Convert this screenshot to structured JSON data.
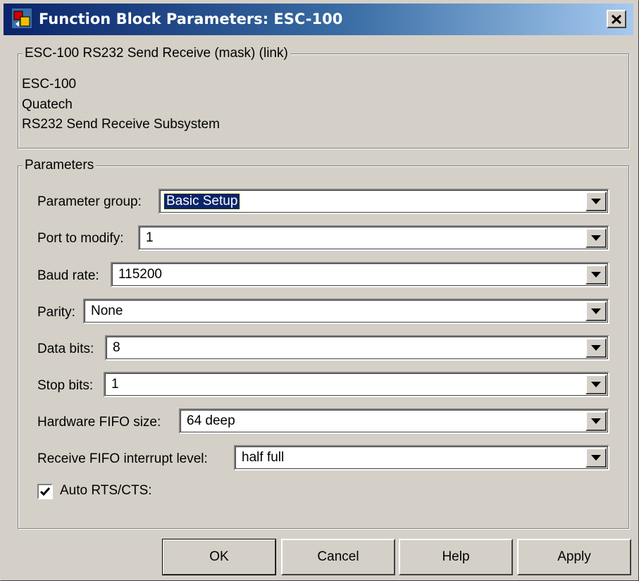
{
  "window": {
    "title": "Function Block Parameters: ESC-100"
  },
  "description": {
    "group_label": "ESC-100 RS232 Send Receive (mask) (link)",
    "lines": [
      "ESC-100",
      "Quatech",
      "RS232 Send Receive Subsystem"
    ]
  },
  "parameters": {
    "group_label": "Parameters",
    "fields": [
      {
        "label": "Parameter group:",
        "value": "Basic Setup"
      },
      {
        "label": "Port to modify:",
        "value": "1"
      },
      {
        "label": "Baud rate:",
        "value": "115200"
      },
      {
        "label": "Parity:",
        "value": "None"
      },
      {
        "label": "Data bits:",
        "value": "8"
      },
      {
        "label": "Stop bits:",
        "value": "1"
      },
      {
        "label": "Hardware FIFO size:",
        "value": "64 deep"
      },
      {
        "label": "Receive FIFO interrupt level:",
        "value": "half full"
      }
    ],
    "checkbox": {
      "label": "Auto RTS/CTS:",
      "checked": true
    }
  },
  "buttons": {
    "ok": "OK",
    "cancel": "Cancel",
    "help": "Help",
    "apply": "Apply"
  },
  "colors": {
    "titlebar_start": "#0a246a",
    "titlebar_end": "#a6caf0",
    "face": "#d4d0c8",
    "selection": "#0a246a"
  },
  "icons": {
    "app": "simulink-block-icon",
    "close": "close-x-icon",
    "dropdown": "triangle-down-icon",
    "check": "checkmark-icon"
  }
}
